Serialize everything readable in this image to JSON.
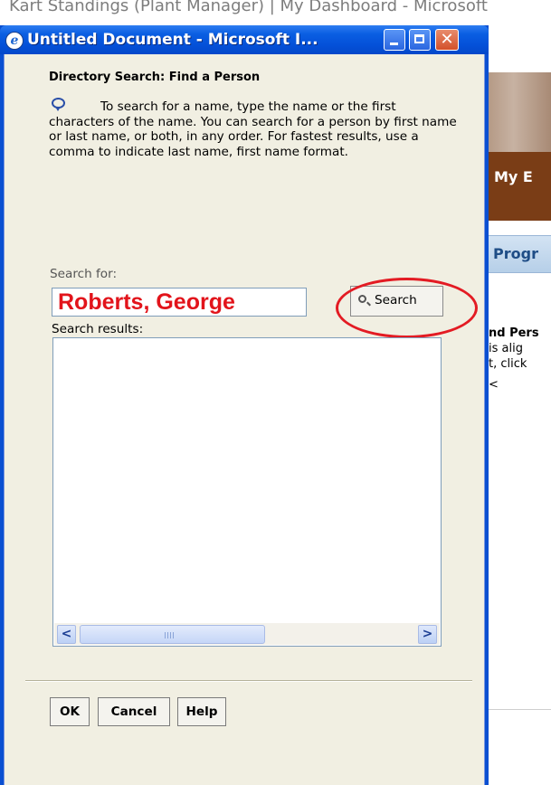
{
  "background": {
    "title_bar_text": "Kart Standings (Plant Manager) | My Dashboard - Microsoft",
    "banner_text": "My E",
    "tab_text": "Progr",
    "snippets": [
      "nd Pers",
      "is alig",
      "t, click",
      "<"
    ]
  },
  "dialog": {
    "window_title": "Untitled Document - Microsoft I...",
    "heading": "Directory Search: Find a Person",
    "instructions": "To search for a name, type the name or the first characters of the name. You can search for a person by first name or last name, or both, in any order. For fastest results, use a comma to indicate last name, first name format.",
    "search_label": "Search for:",
    "search_value": "Roberts, George",
    "search_button": "Search",
    "results_label": "Search results:",
    "buttons": {
      "ok": "OK",
      "cancel": "Cancel",
      "help": "Help"
    }
  },
  "colors": {
    "annotation_red": "#e2141b",
    "titlebar_blue": "#0450d8",
    "dialog_face": "#f1efe2"
  },
  "icons": [
    "ie-icon",
    "minimize-icon",
    "maximize-icon",
    "close-icon",
    "info-icon",
    "magnifier-icon",
    "scroll-left-icon",
    "scroll-right-icon"
  ]
}
